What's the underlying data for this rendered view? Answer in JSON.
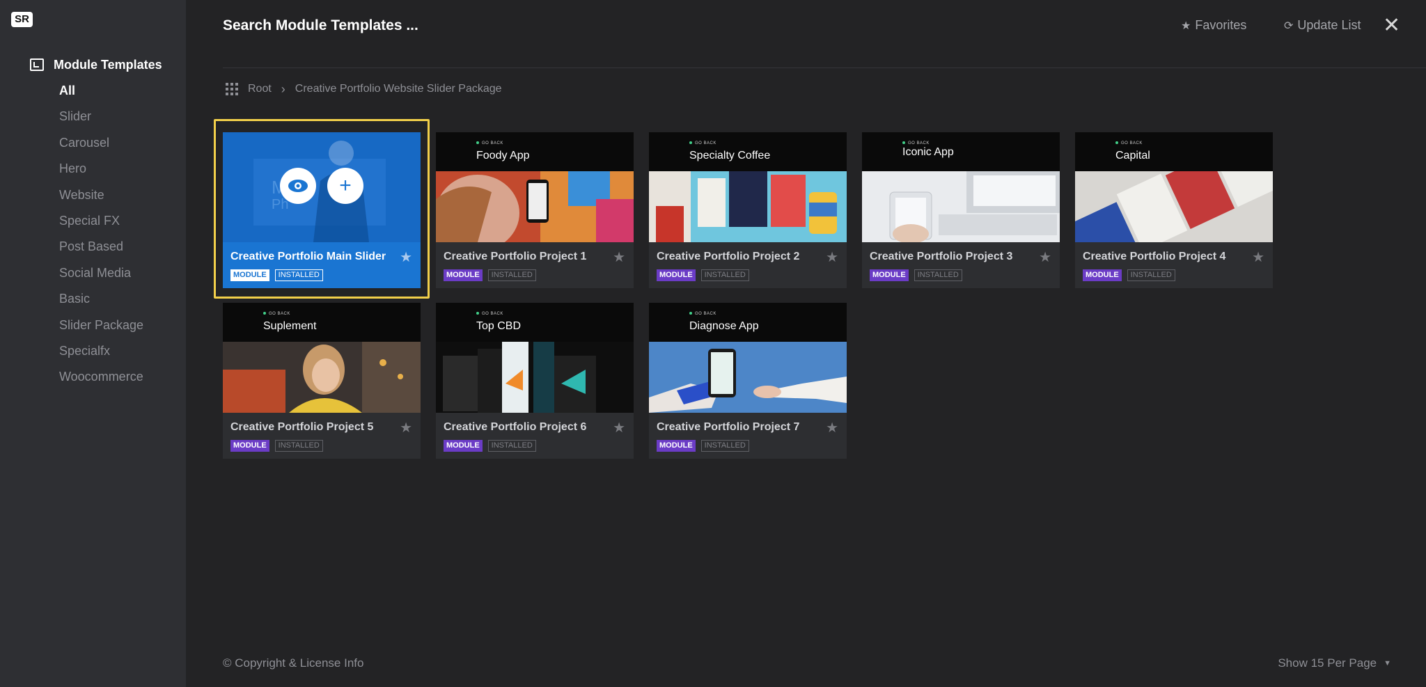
{
  "sidebar": {
    "logo": "SR",
    "title": "Module Templates",
    "items": [
      {
        "label": "All",
        "active": true
      },
      {
        "label": "Slider"
      },
      {
        "label": "Carousel"
      },
      {
        "label": "Hero"
      },
      {
        "label": "Website"
      },
      {
        "label": "Special FX"
      },
      {
        "label": "Post Based"
      },
      {
        "label": "Social Media"
      },
      {
        "label": "Basic"
      },
      {
        "label": "Slider Package"
      },
      {
        "label": "Specialfx"
      },
      {
        "label": "Woocommerce"
      }
    ]
  },
  "header": {
    "search_placeholder": "Search Module Templates ...",
    "favorites_label": "Favorites",
    "update_label": "Update List",
    "close_glyph": "✕"
  },
  "breadcrumb": {
    "root": "Root",
    "current": "Creative Portfolio Website Slider Package"
  },
  "cards": [
    {
      "name": "Creative Portfolio Main Slider",
      "thumb_title": "",
      "badge_module": "MODULE",
      "badge_installed": "INSTALLED",
      "selected": true
    },
    {
      "name": "Creative Portfolio Project 1",
      "thumb_title": "Foody App",
      "badge_module": "MODULE",
      "badge_installed": "INSTALLED"
    },
    {
      "name": "Creative Portfolio Project 2",
      "thumb_title": "Specialty Coffee",
      "badge_module": "MODULE",
      "badge_installed": "INSTALLED"
    },
    {
      "name": "Creative Portfolio Project 3",
      "thumb_title": "Iconic App",
      "badge_module": "MODULE",
      "badge_installed": "INSTALLED"
    },
    {
      "name": "Creative Portfolio Project 4",
      "thumb_title": "Capital",
      "badge_module": "MODULE",
      "badge_installed": "INSTALLED"
    },
    {
      "name": "Creative Portfolio Project 5",
      "thumb_title": "Suplement",
      "badge_module": "MODULE",
      "badge_installed": "INSTALLED"
    },
    {
      "name": "Creative Portfolio Project 6",
      "thumb_title": "Top CBD",
      "badge_module": "MODULE",
      "badge_installed": "INSTALLED"
    },
    {
      "name": "Creative Portfolio Project 7",
      "thumb_title": "Diagnose App",
      "badge_module": "MODULE",
      "badge_installed": "INSTALLED"
    }
  ],
  "thumb_header_tag": "GO BACK",
  "footer": {
    "copyright": "© Copyright & License Info",
    "per_page": "Show 15 Per Page"
  },
  "colors": {
    "accent": "#1a75d2",
    "selection_border": "#f2cf4a",
    "module_badge": "#6b3cc6",
    "sidebar_bg": "#2e2f33",
    "main_bg": "#232325"
  }
}
